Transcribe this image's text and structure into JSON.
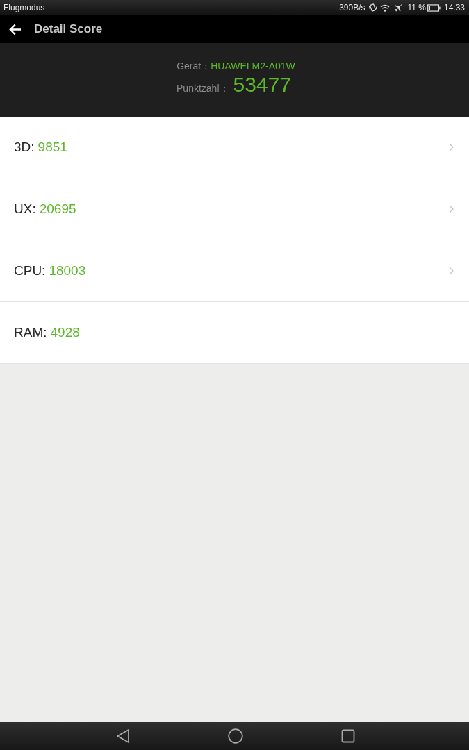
{
  "status_bar": {
    "mode": "Flugmodus",
    "network_speed": "390B/s",
    "battery_percent": "11 %",
    "time": "14:33"
  },
  "toolbar": {
    "title": "Detail Score"
  },
  "summary": {
    "device_label": "Gerät：",
    "device": "HUAWEI M2-A01W",
    "score_label": "Punktzahl：",
    "score": "53477"
  },
  "scores": [
    {
      "label": "3D:",
      "value": "9851",
      "expandable": true
    },
    {
      "label": "UX:",
      "value": "20695",
      "expandable": true
    },
    {
      "label": "CPU:",
      "value": "18003",
      "expandable": true
    },
    {
      "label": "RAM:",
      "value": "4928",
      "expandable": false
    }
  ]
}
